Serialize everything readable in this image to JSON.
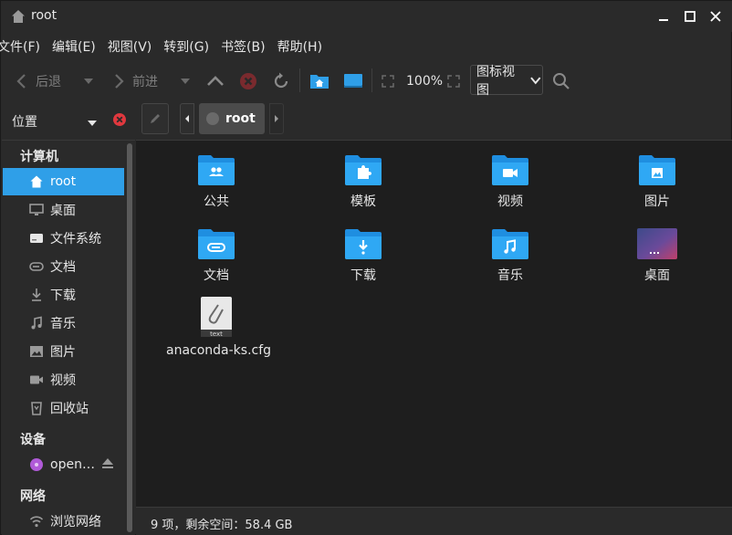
{
  "window": {
    "title": "root"
  },
  "menu": [
    "文件(F)",
    "编辑(E)",
    "视图(V)",
    "转到(G)",
    "书签(B)",
    "帮助(H)"
  ],
  "toolbar": {
    "back_label": "后退",
    "forward_label": "前进",
    "zoom": "100%",
    "view_mode": "图标视图"
  },
  "location": {
    "label": "位置",
    "crumb": "root"
  },
  "sidebar": {
    "sections": {
      "computer": "计算机",
      "devices": "设备",
      "network": "网络"
    },
    "items": [
      {
        "label": "root",
        "icon": "home-icon"
      },
      {
        "label": "桌面",
        "icon": "desktop-icon"
      },
      {
        "label": "文件系统",
        "icon": "drive-icon"
      },
      {
        "label": "文档",
        "icon": "document-icon"
      },
      {
        "label": "下载",
        "icon": "download-icon"
      },
      {
        "label": "音乐",
        "icon": "music-icon"
      },
      {
        "label": "图片",
        "icon": "picture-icon"
      },
      {
        "label": "视频",
        "icon": "video-icon"
      },
      {
        "label": "回收站",
        "icon": "trash-icon"
      }
    ],
    "device": {
      "label": "open…",
      "icon": "disc-icon"
    },
    "network_item": {
      "label": "浏览网络",
      "icon": "wifi-icon"
    }
  },
  "files": [
    {
      "name": "公共",
      "icon": "folder-public-icon"
    },
    {
      "name": "模板",
      "icon": "folder-templates-icon"
    },
    {
      "name": "视频",
      "icon": "folder-videos-icon"
    },
    {
      "name": "图片",
      "icon": "folder-pictures-icon"
    },
    {
      "name": "文档",
      "icon": "folder-documents-icon"
    },
    {
      "name": "下载",
      "icon": "folder-downloads-icon"
    },
    {
      "name": "音乐",
      "icon": "folder-music-icon"
    },
    {
      "name": "桌面",
      "icon": "folder-desktop-icon"
    },
    {
      "name": "anaconda-ks.cfg",
      "icon": "text-file-icon",
      "badge": "text"
    }
  ],
  "status": "9 项，剩余空间：58.4 GB",
  "colors": {
    "accent": "#2f9fe8",
    "folder": "#2f9fe8",
    "close_red": "#e0383e"
  }
}
